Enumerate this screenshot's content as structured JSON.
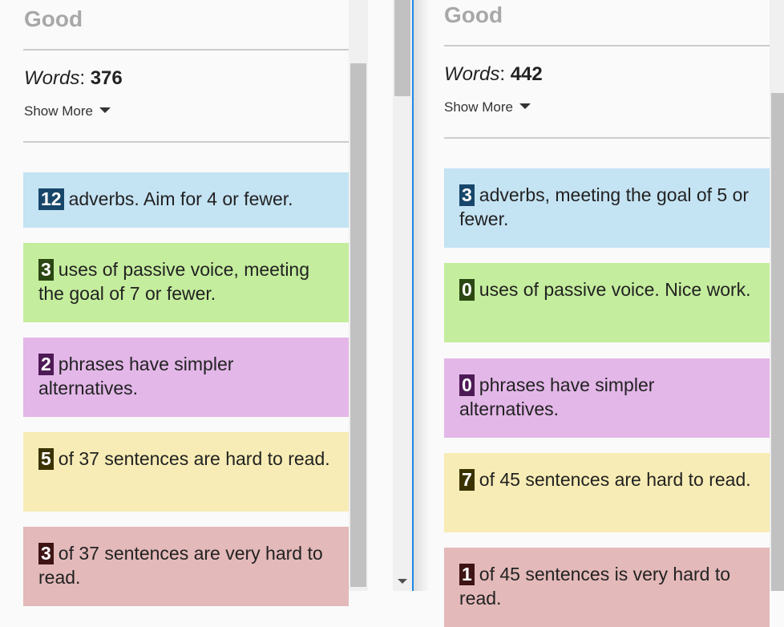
{
  "left": {
    "grade": "Good",
    "words_label": "Words",
    "words_count": "376",
    "show_more": "Show More",
    "cards": [
      {
        "num": "12",
        "text": "adverbs. Aim for 4 or fewer."
      },
      {
        "num": "3",
        "text": "uses of passive voice, meeting the goal of 7 or fewer."
      },
      {
        "num": "2",
        "text": "phrases have simpler alternatives."
      },
      {
        "num": "5",
        "text": "of 37 sentences are hard to read."
      },
      {
        "num": "3",
        "text": "of 37 sentences are very hard to read."
      }
    ]
  },
  "right": {
    "grade": "Good",
    "words_label": "Words",
    "words_count": "442",
    "show_more": "Show More",
    "cards": [
      {
        "num": "3",
        "text": "adverbs, meeting the goal of 5 or fewer."
      },
      {
        "num": "0",
        "text": "uses of passive voice. Nice work."
      },
      {
        "num": "0",
        "text": "phrases have simpler alternatives."
      },
      {
        "num": "7",
        "text": "of 45 sentences are hard to read."
      },
      {
        "num": "1",
        "text": "of 45 sentences is very hard to read."
      }
    ]
  },
  "colors": {
    "adverb_bg": "#c4e3f3",
    "adverb_badge": "#17466a",
    "passive_bg": "#c4ed9d",
    "passive_badge": "#2b4712",
    "simpler_bg": "#e3b7e8",
    "simpler_badge": "#4e1a55",
    "hard_bg": "#f7ecb5",
    "hard_badge": "#3a3300",
    "veryhard_bg": "#e4b9b9",
    "veryhard_badge": "#3e1414"
  }
}
